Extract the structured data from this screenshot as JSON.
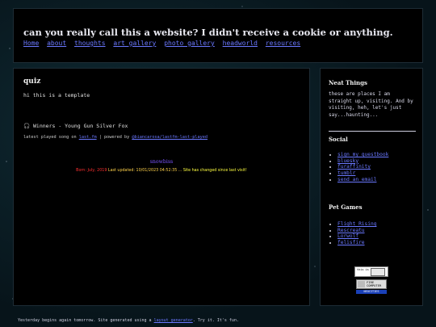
{
  "header": {
    "title": "can you really call this a website? I didn't receive a cookie or anything.",
    "nav": [
      "Home",
      "about",
      "thoughts",
      "art gallery",
      "photo gallery",
      "headworld",
      "resources"
    ]
  },
  "main": {
    "heading": "quiz",
    "intro": "hi this is a template",
    "song": {
      "icon": "headphones-icon",
      "text": "Winners - Young Gun Silver Fox"
    },
    "lastfm": {
      "prefix": "latest played song on",
      "link1": "last.fm",
      "separator": "| powered by",
      "link2": "@biancarosa/lastfm-last-played"
    },
    "counter": {
      "name": "snowbiss",
      "born_label": "Born:",
      "born_date": "July, 2019",
      "updated_label": "Last updated:",
      "updated_date": "10/01/2023 04:52:35",
      "ellipsis": "...",
      "message": "Site has changed since last visit!"
    }
  },
  "sidebar": {
    "neat": {
      "title": "Neat Things",
      "text": "these are places I am straight up, visiting. And by visiting, heh, let's just say...haunting..."
    },
    "social": {
      "title": "Social",
      "links": [
        "sign my guestbook",
        "bluesky",
        "furaffinity",
        "tumblr",
        "send an email"
      ]
    },
    "pet_games": {
      "title": "Pet Games",
      "links": [
        "Flight Rising",
        "Rescreatu",
        "Lorwolf",
        "felisfire"
      ]
    },
    "badges": {
      "badge1": "this is my fault",
      "badge2_line1": "FIRE",
      "badge2_line2": "COMPUTER",
      "badge3": "NEOCITIES"
    }
  },
  "footer": {
    "before": "Yesterday begins again tomorrow. Site generated using a",
    "link": "layout generator",
    "after": ". Try it. It's fun."
  },
  "colors": {
    "link": "#6a78ff",
    "counter_name": "#7b55ff",
    "born": "#ff3030",
    "updated": "#ffd24a",
    "message": "#ffff40"
  }
}
